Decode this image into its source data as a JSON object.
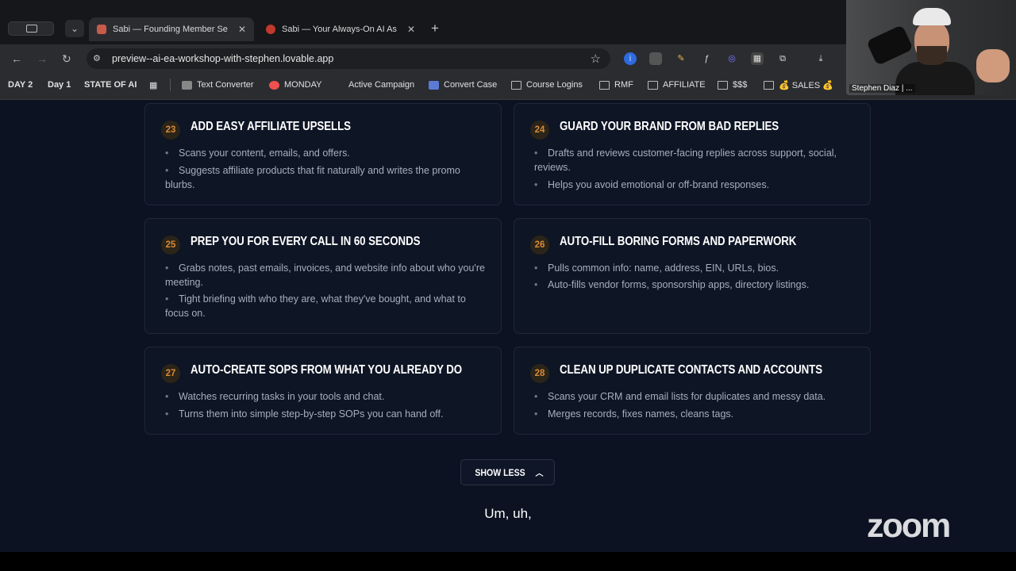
{
  "browser": {
    "tabs": [
      {
        "title": "Sabi — Founding Member Se",
        "active": true
      },
      {
        "title": "Sabi — Your Always-On AI As",
        "active": false
      }
    ],
    "new_tab": "+",
    "url": "preview--ai-ea-workshop-with-stephen.lovable.app",
    "bookmarks": [
      "DAY 2",
      "Day 1",
      "STATE OF AI",
      "Text Converter",
      "MONDAY",
      "Active Campaign",
      "Convert Case",
      "Course Logins",
      "RMF",
      "AFFILIATE",
      "$$$",
      "💰 SALES 💰"
    ]
  },
  "cards": [
    {
      "num": "23",
      "title": "ADD EASY AFFILIATE UPSELLS",
      "bullets": [
        "Scans your content, emails, and offers.",
        "Suggests affiliate products that fit naturally and writes the promo blurbs."
      ]
    },
    {
      "num": "24",
      "title": "GUARD YOUR BRAND FROM BAD REPLIES",
      "bullets": [
        "Drafts and reviews customer-facing replies across support, social, reviews.",
        "Helps you avoid emotional or off-brand responses."
      ]
    },
    {
      "num": "25",
      "title": "PREP YOU FOR EVERY CALL IN 60 SECONDS",
      "bullets": [
        "Grabs notes, past emails, invoices, and website info about who you're meeting.",
        "Tight briefing with who they are, what they've bought, and what to focus on."
      ]
    },
    {
      "num": "26",
      "title": "AUTO-FILL BORING FORMS AND PAPERWORK",
      "bullets": [
        "Pulls common info: name, address, EIN, URLs, bios.",
        "Auto-fills vendor forms, sponsorship apps, directory listings."
      ]
    },
    {
      "num": "27",
      "title": "AUTO-CREATE SOPS FROM WHAT YOU ALREADY DO",
      "bullets": [
        "Watches recurring tasks in your tools and chat.",
        "Turns them into simple step-by-step SOPs you can hand off."
      ]
    },
    {
      "num": "28",
      "title": "CLEAN UP DUPLICATE CONTACTS AND ACCOUNTS",
      "bullets": [
        "Scans your CRM and email lists for duplicates and messy data.",
        "Merges records, fixes names, cleans tags."
      ]
    }
  ],
  "show_less_label": "SHOW LESS",
  "caption": "Um, uh,",
  "zoom_logo": "zoom",
  "webcam": {
    "name": "Stephen Diaz | ..."
  },
  "colors": {
    "page_bg": "#0c1221",
    "card_bg": "#0e1525",
    "accent": "#d98a3a"
  }
}
